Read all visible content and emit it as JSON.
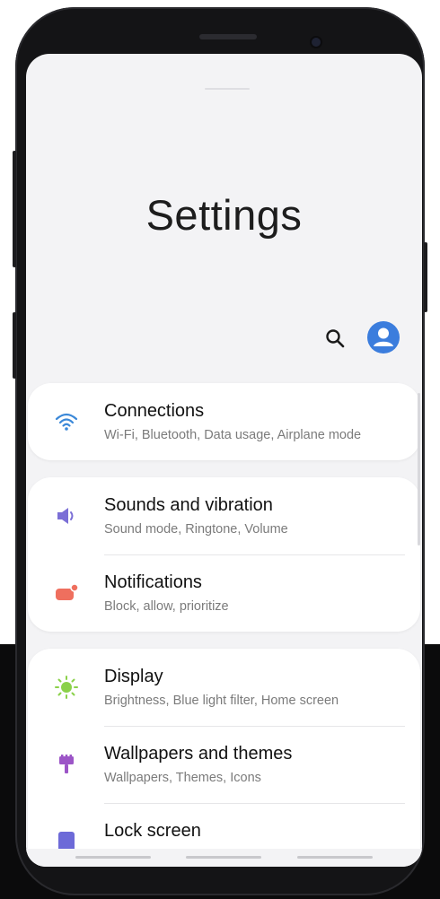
{
  "screen": {
    "title": "Settings"
  },
  "header": {
    "search_icon": "search-icon",
    "account_icon": "account-icon",
    "accent_color": "#3b7ddd"
  },
  "groups": [
    {
      "items": [
        {
          "label": "Connections",
          "subtitle": "Wi-Fi, Bluetooth, Data usage, Airplane mode",
          "icon": "wifi-icon",
          "color": "#3b88d8"
        }
      ]
    },
    {
      "items": [
        {
          "label": "Sounds and vibration",
          "subtitle": "Sound mode, Ringtone, Volume",
          "icon": "speaker-icon",
          "color": "#7b6fd6"
        },
        {
          "label": "Notifications",
          "subtitle": "Block, allow, prioritize",
          "icon": "notification-icon",
          "color": "#ef6f5e"
        }
      ]
    },
    {
      "items": [
        {
          "label": "Display",
          "subtitle": "Brightness, Blue light filter, Home screen",
          "icon": "sun-icon",
          "color": "#8bd14a"
        },
        {
          "label": "Wallpapers and themes",
          "subtitle": "Wallpapers, Themes, Icons",
          "icon": "paintbrush-icon",
          "color": "#9c55c7"
        },
        {
          "label": "Lock screen",
          "subtitle": "",
          "icon": "lock-screen-icon",
          "color": "#6d6ad8"
        }
      ]
    }
  ]
}
